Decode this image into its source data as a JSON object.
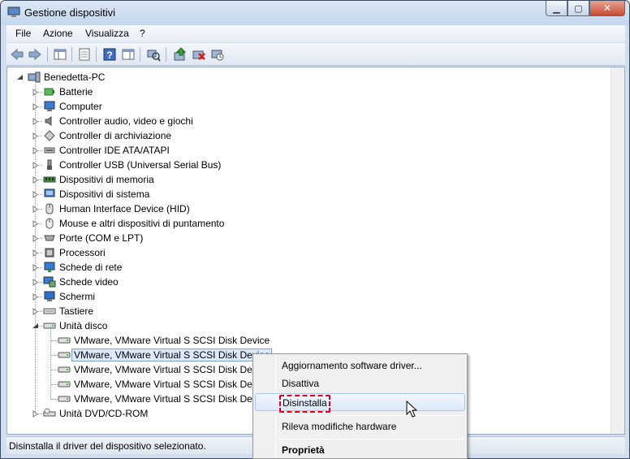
{
  "window": {
    "title": "Gestione dispositivi"
  },
  "menu": [
    "File",
    "Azione",
    "Visualizza",
    "?"
  ],
  "tree": {
    "root": "Benedetta-PC",
    "categories": [
      {
        "label": "Batterie",
        "icon": "battery-icon"
      },
      {
        "label": "Computer",
        "icon": "computer-icon"
      },
      {
        "label": "Controller audio, video e giochi",
        "icon": "speaker-icon"
      },
      {
        "label": "Controller di archiviazione",
        "icon": "storage-controller-icon"
      },
      {
        "label": "Controller IDE ATA/ATAPI",
        "icon": "ide-controller-icon"
      },
      {
        "label": "Controller USB (Universal Serial Bus)",
        "icon": "usb-icon"
      },
      {
        "label": "Dispositivi di memoria",
        "icon": "memory-icon"
      },
      {
        "label": "Dispositivi di sistema",
        "icon": "system-device-icon"
      },
      {
        "label": "Human Interface Device (HID)",
        "icon": "hid-icon"
      },
      {
        "label": "Mouse e altri dispositivi di puntamento",
        "icon": "mouse-icon"
      },
      {
        "label": "Porte (COM e LPT)",
        "icon": "port-icon"
      },
      {
        "label": "Processori",
        "icon": "processor-icon"
      },
      {
        "label": "Schede di rete",
        "icon": "network-card-icon"
      },
      {
        "label": "Schede video",
        "icon": "video-card-icon"
      },
      {
        "label": "Schermi",
        "icon": "monitor-icon"
      },
      {
        "label": "Tastiere",
        "icon": "keyboard-icon"
      },
      {
        "label": "Unità disco",
        "icon": "disk-drive-icon"
      }
    ],
    "disks": [
      "VMware, VMware Virtual S SCSI Disk Device",
      "VMware, VMware Virtual S SCSI Disk Device",
      "VMware, VMware Virtual S SCSI Disk Device",
      "VMware, VMware Virtual S SCSI Disk Device",
      "VMware, VMware Virtual S SCSI Disk Device"
    ],
    "last": {
      "label": "Unità DVD/CD-ROM",
      "icon": "dvd-drive-icon"
    }
  },
  "context_menu": {
    "items": [
      "Aggiornamento software driver...",
      "Disattiva",
      "Disinstalla",
      "Rileva modifiche hardware",
      "Proprietà"
    ],
    "hover_item": "Disinstalla"
  },
  "status": {
    "text": "Disinstalla il driver del dispositivo selezionato."
  },
  "colors": {
    "highlight_box": "#e0001b",
    "selection": "#dbe9fb"
  }
}
